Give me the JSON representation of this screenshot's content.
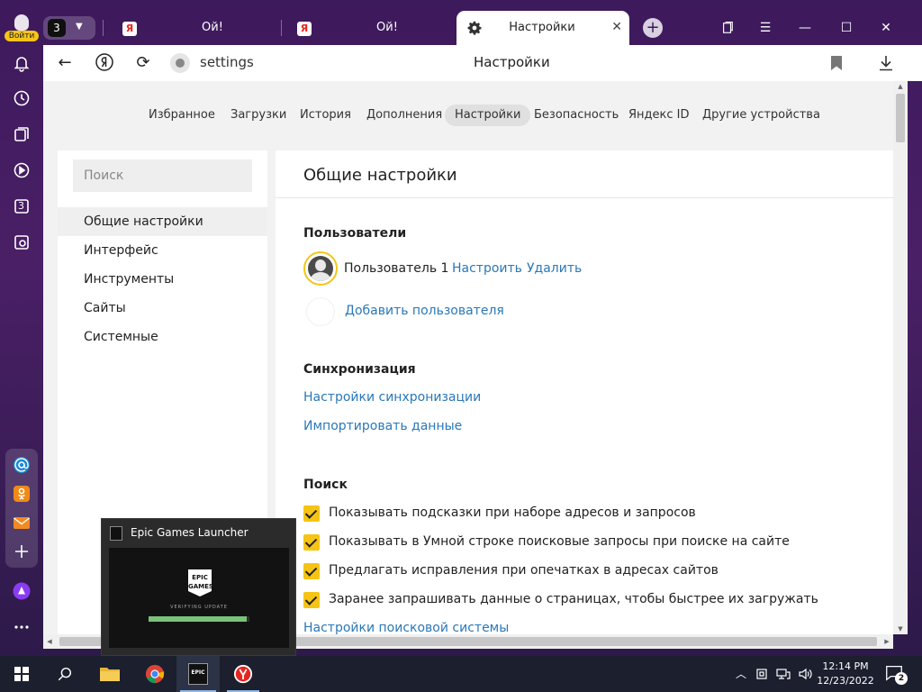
{
  "sidebar": {
    "login_label": "Войти",
    "tab_counter_badge": "3"
  },
  "tabs": {
    "count": "3",
    "items": [
      {
        "title": "Ой!",
        "favicon_letter": "Я"
      },
      {
        "title": "Ой!",
        "favicon_letter": "Я"
      },
      {
        "title": "Настройки",
        "active": true
      }
    ]
  },
  "addressbar": {
    "url": "settings",
    "page_title": "Настройки"
  },
  "topnav": {
    "items": [
      "Избранное",
      "Загрузки",
      "История",
      "Дополнения",
      "Настройки",
      "Безопасность",
      "Яндекс ID",
      "Другие устройства"
    ],
    "active": "Настройки"
  },
  "leftnav": {
    "search_placeholder": "Поиск",
    "items": [
      "Общие настройки",
      "Интерфейс",
      "Инструменты",
      "Сайты",
      "Системные"
    ],
    "active": "Общие настройки"
  },
  "content": {
    "title": "Общие настройки",
    "users": {
      "heading": "Пользователи",
      "user_name": "Пользователь 1",
      "configure_link": "Настроить",
      "delete_link": "Удалить",
      "add_user_link": "Добавить пользователя"
    },
    "sync": {
      "heading": "Синхронизация",
      "sync_settings_link": "Настройки синхронизации",
      "import_link": "Импортировать данные"
    },
    "search": {
      "heading": "Поиск",
      "options": [
        {
          "label": "Показывать подсказки при наборе адресов и запросов",
          "checked": true
        },
        {
          "label": "Показывать в Умной строке поисковые запросы при поиске на сайте",
          "checked": true
        },
        {
          "label": "Предлагать исправления при опечатках в адресах сайтов",
          "checked": true
        },
        {
          "label": "Заранее запрашивать данные о страницах, чтобы быстрее их загружать",
          "checked": true
        }
      ],
      "engine_settings_link": "Настройки поисковой системы"
    }
  },
  "taskbar_preview": {
    "title": "Epic Games Launcher",
    "logo_text": "EPIC GAMES",
    "status_text": "VERIFYING UPDATE",
    "progress_fraction": 0.97
  },
  "taskbar": {
    "epic_icon_text": "EPIC",
    "clock_time": "12:14 PM",
    "clock_date": "12/23/2022",
    "notification_count": "2"
  },
  "colors": {
    "accent_yellow": "#f5c414",
    "link_blue": "#2a78b8",
    "chrome_purple": "#4a1f66"
  }
}
